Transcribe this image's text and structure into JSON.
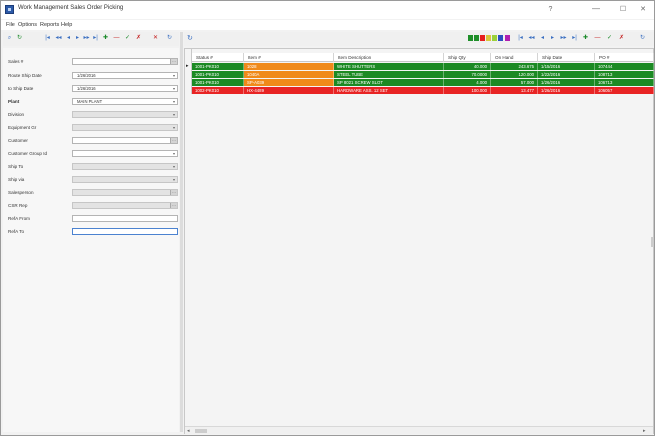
{
  "window": {
    "title": "Work Management Sales Order Picking",
    "help_glyph": "?",
    "minimize_glyph": "—",
    "maximize_glyph": "☐",
    "close_glyph": "✕"
  },
  "menu": [
    "File",
    "Options",
    "Reports",
    "Help"
  ],
  "icons": {
    "app": "app-icon",
    "left_toolbar": [
      "binoculars-icon",
      "refresh-icon",
      "first-record-icon",
      "previous-page-icon",
      "previous-record-icon",
      "next-record-icon",
      "next-page-icon",
      "last-record-icon",
      "add-icon",
      "delete-icon",
      "edit-icon",
      "save-icon",
      "cancel-icon",
      "refresh-icon"
    ],
    "right_toolbar": [
      "first-record-icon",
      "previous-page-icon",
      "previous-record-icon",
      "next-record-icon",
      "next-page-icon",
      "last-record-icon",
      "add-icon",
      "delete-icon",
      "edit-icon",
      "save-icon",
      "cancel-icon",
      "refresh-icon"
    ]
  },
  "left_toolbar_glyphs": [
    "⌕",
    "↻",
    "|◂",
    "◂◂",
    "◂",
    "▸",
    "▸▸",
    "▸|",
    "✚",
    "—",
    "✓",
    "✗",
    "✕",
    "↻"
  ],
  "right_toolbar_glyphs": [
    "|◂",
    "◂◂",
    "◂",
    "▸",
    "▸▸",
    "▸|",
    "✚",
    "—",
    "✓",
    "✗",
    "↻"
  ],
  "colors": {
    "green": "#1c8a24",
    "orange": "#f08a1a",
    "red": "#e82424",
    "status_squares": [
      "#1f8f2a",
      "#1f8f2a",
      "#e61e1e",
      "#d8c83a",
      "#9ad13a",
      "#2a4fbf",
      "#b01fb0"
    ]
  },
  "form": {
    "fields": [
      {
        "label": "Sales #",
        "value": "",
        "type": "ellipsis",
        "disabled": false
      },
      {
        "label": "Route Ship Date",
        "value": "1/26/2016",
        "type": "dropdown",
        "disabled": false
      },
      {
        "label": "to Ship Date",
        "value": "1/26/2016",
        "type": "dropdown",
        "disabled": false
      },
      {
        "label": "Plant",
        "value": "MAIN PLANT",
        "type": "dropdown",
        "disabled": false
      },
      {
        "label": "Division",
        "value": "",
        "type": "dropdown",
        "disabled": true
      },
      {
        "label": "Equipment Gr",
        "value": "",
        "type": "dropdown",
        "disabled": true
      },
      {
        "label": "Customer",
        "value": "",
        "type": "ellipsis",
        "disabled": false
      },
      {
        "label": "Customer Group Id",
        "value": "",
        "type": "dropdown",
        "disabled": false
      },
      {
        "label": "Ship To",
        "value": "",
        "type": "dropdown",
        "disabled": true
      },
      {
        "label": "Ship via",
        "value": "",
        "type": "dropdown",
        "disabled": true
      },
      {
        "label": "Salesperson",
        "value": "",
        "type": "ellipsis",
        "disabled": true
      },
      {
        "label": "CSR Rep",
        "value": "",
        "type": "ellipsis",
        "disabled": true
      },
      {
        "label": "RefA From",
        "value": "",
        "type": "text",
        "disabled": false
      },
      {
        "label": "RefA To",
        "value": "",
        "type": "text",
        "disabled": false
      }
    ]
  },
  "grid": {
    "columns": [
      "Status #",
      "Item #",
      "Item Description",
      "Ship Qty",
      "On Hand",
      "Ship Date",
      "PO #"
    ],
    "rows": [
      {
        "color": "green",
        "cells": [
          "1001-PK010",
          "1028",
          "WHITE SHUTTERS",
          "40.000",
          "243.675",
          "1/15/2016",
          "107444"
        ],
        "item_color": "orange"
      },
      {
        "color": "green",
        "cells": [
          "1001-PK010",
          "1040A",
          "STEEL TUBE",
          "70.0000",
          "120.000",
          "1/22/2016",
          "108713"
        ],
        "item_color": "orange"
      },
      {
        "color": "green",
        "cells": [
          "1001-PK010",
          "SP-A039",
          "SP 8021 SCREW SLOT",
          "4.000",
          "57.000",
          "1/26/2016",
          "106713"
        ],
        "item_color": "orange"
      },
      {
        "color": "red",
        "cells": [
          "1002-PK010",
          "HX-4489",
          "HARDWARE ASS. 12 SET",
          "100.000",
          "13.477",
          "1/26/2016",
          "106057"
        ],
        "item_color": "red"
      }
    ]
  },
  "scroll": {
    "left": "◂",
    "right": "▸"
  }
}
